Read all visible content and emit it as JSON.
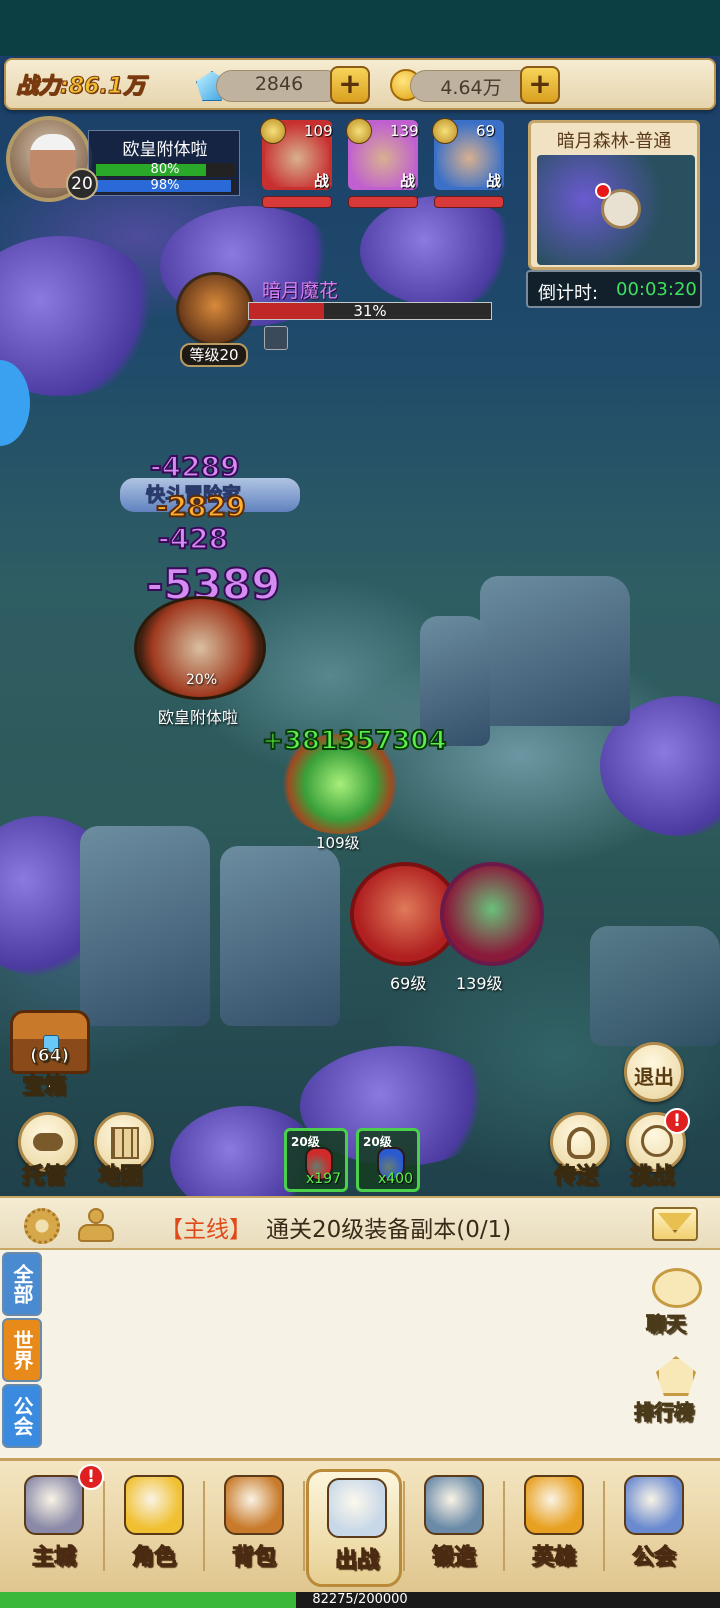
{
  "top_bar": {
    "power_label": "战力:86.1万",
    "gems": "2846",
    "gold": "4.64万",
    "plus_symbol": "+"
  },
  "player": {
    "name": "欧皇附体啦",
    "level": "20",
    "hp_percent_label": "80%",
    "mp_percent_label": "98%",
    "hp_fraction": 0.8,
    "mp_fraction": 0.98
  },
  "heroes": [
    {
      "level": "109",
      "tag": "战",
      "color": "#c83030",
      "icon": "orc-portrait"
    },
    {
      "level": "139",
      "tag": "战",
      "color": "#c060d0",
      "icon": "dwarf-portrait"
    },
    {
      "level": "69",
      "tag": "战",
      "color": "#3a70c8",
      "icon": "warrior-portrait"
    }
  ],
  "minimap": {
    "title": "暗月森林-普通",
    "timer_label": "倒计时:",
    "timer_value": "00:03:20"
  },
  "boss": {
    "name": "暗月魔花",
    "level_label": "等级20",
    "hp_label": "31%",
    "hp_fraction": 0.31,
    "unit_level": "109级"
  },
  "battle": {
    "damage_numbers": [
      "-4289",
      "-2829",
      "-428",
      "-5389"
    ],
    "heal_number": "+381357304",
    "skill_text": "快斗冒险家",
    "player_unit_name": "欧皇附体啦",
    "player_unit_pct": "20%",
    "hero_unit_levels": [
      "69级",
      "139级"
    ]
  },
  "actions": {
    "chest_count": "(64)",
    "chest_label": "宝箱",
    "auto_label": "托管",
    "map_label": "地图",
    "exit_label": "退出",
    "teleport_label": "传送",
    "challenge_label": "挑战",
    "notif_mark": "!"
  },
  "potions": [
    {
      "level": "20级",
      "count": "x197",
      "color": "#d02a2a"
    },
    {
      "level": "20级",
      "count": "x400",
      "color": "#2a5ad0"
    }
  ],
  "quest": {
    "tag": "【主线】",
    "text": "通关20级装备副本(0/1)"
  },
  "chat": {
    "tabs": [
      "全部",
      "世界",
      "公会"
    ],
    "chat_label": "聊天",
    "rank_label": "排行榜"
  },
  "nav": {
    "items": [
      "主城",
      "角色",
      "背包",
      "出战",
      "锻造",
      "英雄",
      "公会"
    ],
    "active_index": 3
  },
  "exp": {
    "label": "82275/200000",
    "fraction": 0.411
  }
}
